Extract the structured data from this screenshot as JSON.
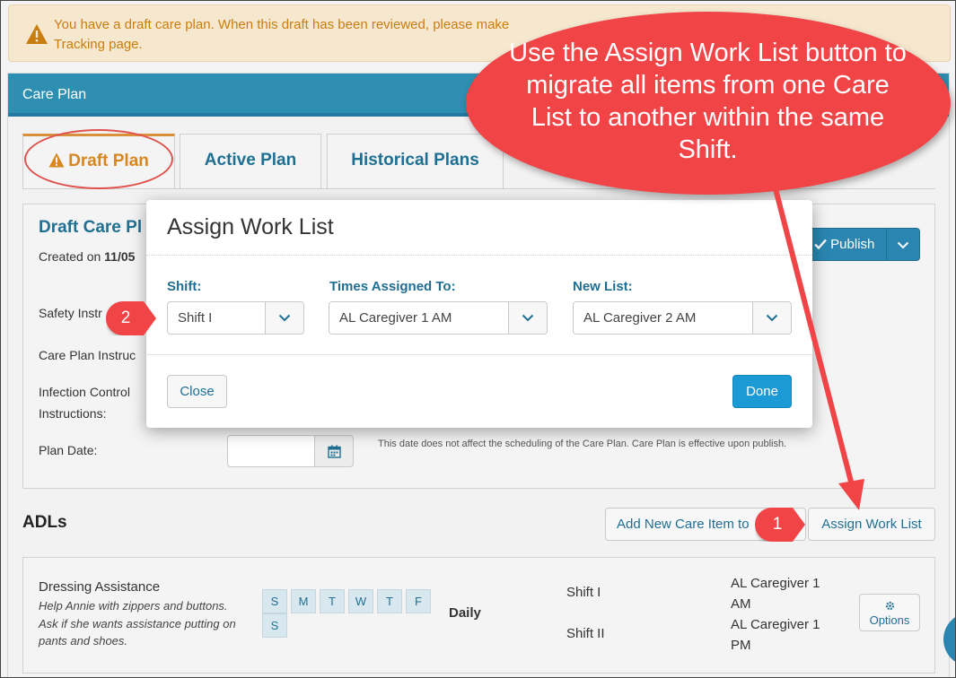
{
  "alert": {
    "text": "You have a draft care plan. When this draft has been reviewed, please make Tracking page."
  },
  "panel": {
    "title": "Care Plan"
  },
  "tabs": [
    {
      "label": "Draft Plan",
      "active": true
    },
    {
      "label": "Active Plan",
      "active": false
    },
    {
      "label": "Historical Plans",
      "active": false
    }
  ],
  "draft": {
    "title": "Draft Care Pl",
    "created_prefix": "Created on ",
    "created_date": "11/05",
    "publish_label": "Publish",
    "fields": {
      "safety": "Safety Instr",
      "care_plan": "Care Plan Instruc",
      "infection": "Infection Control Instructions:",
      "plan_date": "Plan Date:"
    },
    "plan_date_note": "This date does not affect the scheduling of the Care Plan. Care Plan is effective upon publish."
  },
  "adls": {
    "title": "ADLs",
    "add_label": "Add New Care Item to",
    "assign_label": "Assign Work List",
    "item": {
      "name": "Dressing Assistance",
      "description": "Help Annie with zippers and buttons. Ask if she wants assistance putting on pants and shoes.",
      "days": [
        "S",
        "M",
        "T",
        "W",
        "T",
        "F",
        "S"
      ],
      "frequency": "Daily",
      "shifts": [
        "Shift I",
        "Shift II"
      ],
      "caregivers": [
        "AL Caregiver 1 AM",
        "AL Caregiver 1 PM"
      ],
      "options_label": "Options"
    }
  },
  "modal": {
    "title": "Assign Work List",
    "shift_label": "Shift:",
    "shift_value": "Shift I",
    "times_label": "Times Assigned To:",
    "times_value": "AL Caregiver 1 AM",
    "newlist_label": "New List:",
    "newlist_value": "AL Caregiver 2 AM",
    "close_label": "Close",
    "done_label": "Done"
  },
  "annotations": {
    "bubble_text": "Use the Assign Work List button to migrate all items from one Care List to another within the same Shift.",
    "badge_1": "1",
    "badge_2": "2",
    "color": "#f04447"
  },
  "colors": {
    "accent": "#1f6f93",
    "header": "#2e8fb2",
    "warning": "#c87d11",
    "primary_button": "#1c9ad6"
  }
}
